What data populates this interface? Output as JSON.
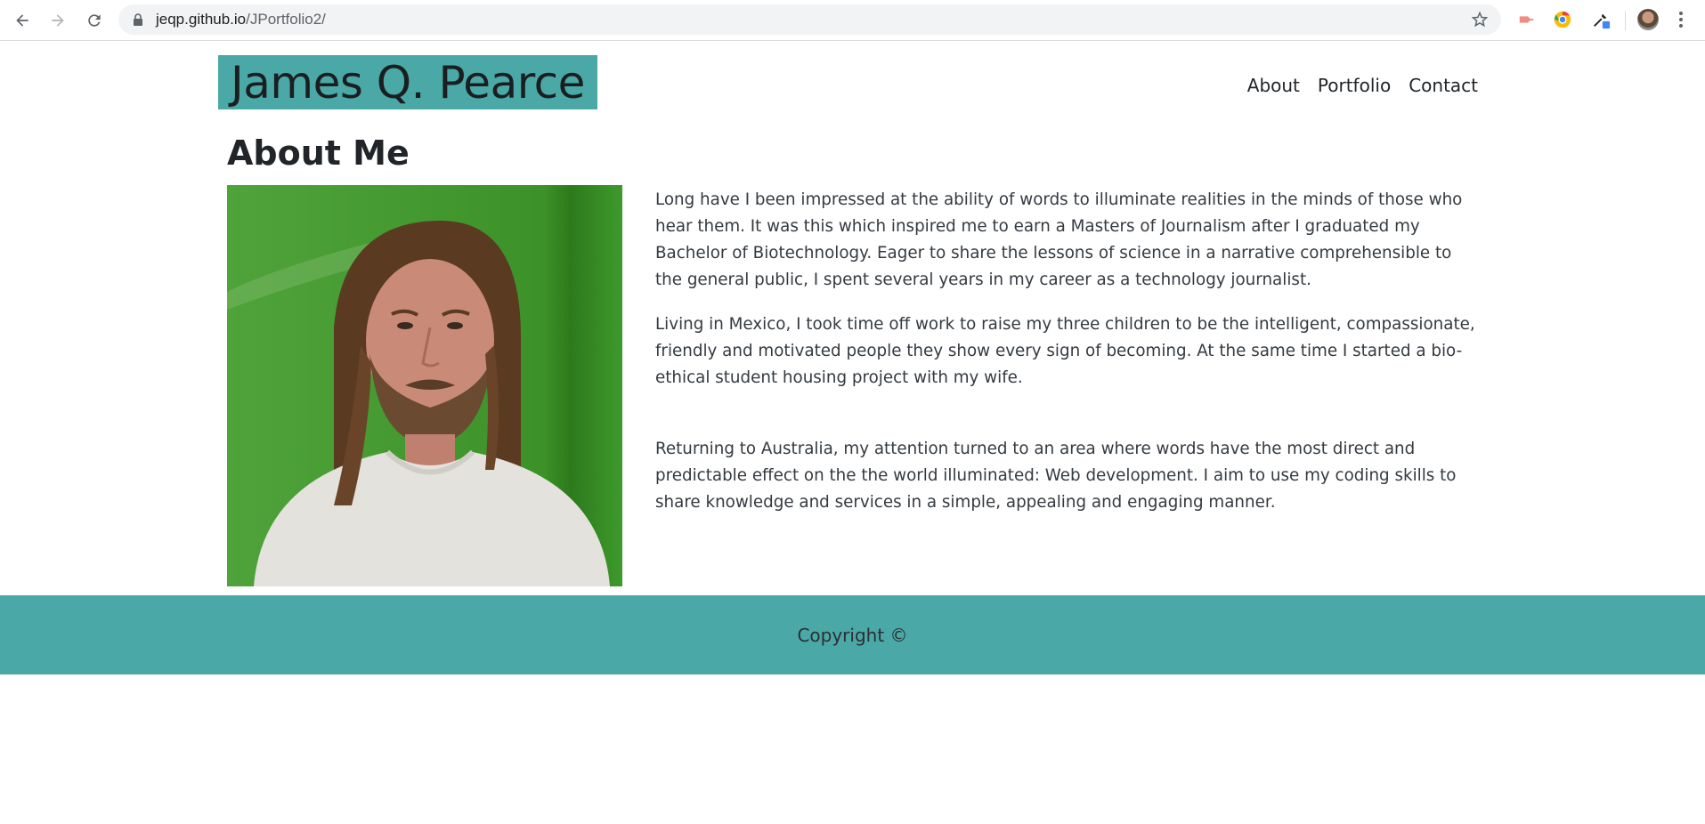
{
  "browser": {
    "url_host": "jeqp.github.io",
    "url_path": "/JPortfolio2/",
    "icons": [
      "back-icon",
      "forward-icon",
      "reload-icon",
      "lock-icon",
      "star-icon",
      "extension-icon",
      "chrome-extension-icon",
      "eyedropper-icon",
      "profile-avatar",
      "menu-icon"
    ]
  },
  "header": {
    "brand": "James Q. Pearce",
    "nav": [
      "About",
      "Portfolio",
      "Contact"
    ]
  },
  "about": {
    "title": "About Me",
    "paragraphs": [
      "Long have I been impressed at the ability of words to illuminate realities in the minds of those who hear them. It was this which inspired me to earn a Masters of Journalism after I graduated my Bachelor of Biotechnology. Eager to share the lessons of science in a narrative comprehensible to the general public, I spent several years in my career as a technology journalist.",
      "Living in Mexico, I took time off work to raise my three children to be the intelligent, compassionate, friendly and motivated people they show every sign of becoming. At the same time I started a bio-ethical student housing project with my wife.",
      "Returning to Australia, my attention turned to an area where words have the most direct and predictable effect on the the world illuminated: Web development. I aim to use my coding skills to share knowledge and services in a simple, appealing and engaging manner."
    ]
  },
  "footer": {
    "text": "Copyright ©"
  },
  "colors": {
    "accent": "#4aa9a6",
    "portrait_bg": "#3f9a2a"
  }
}
